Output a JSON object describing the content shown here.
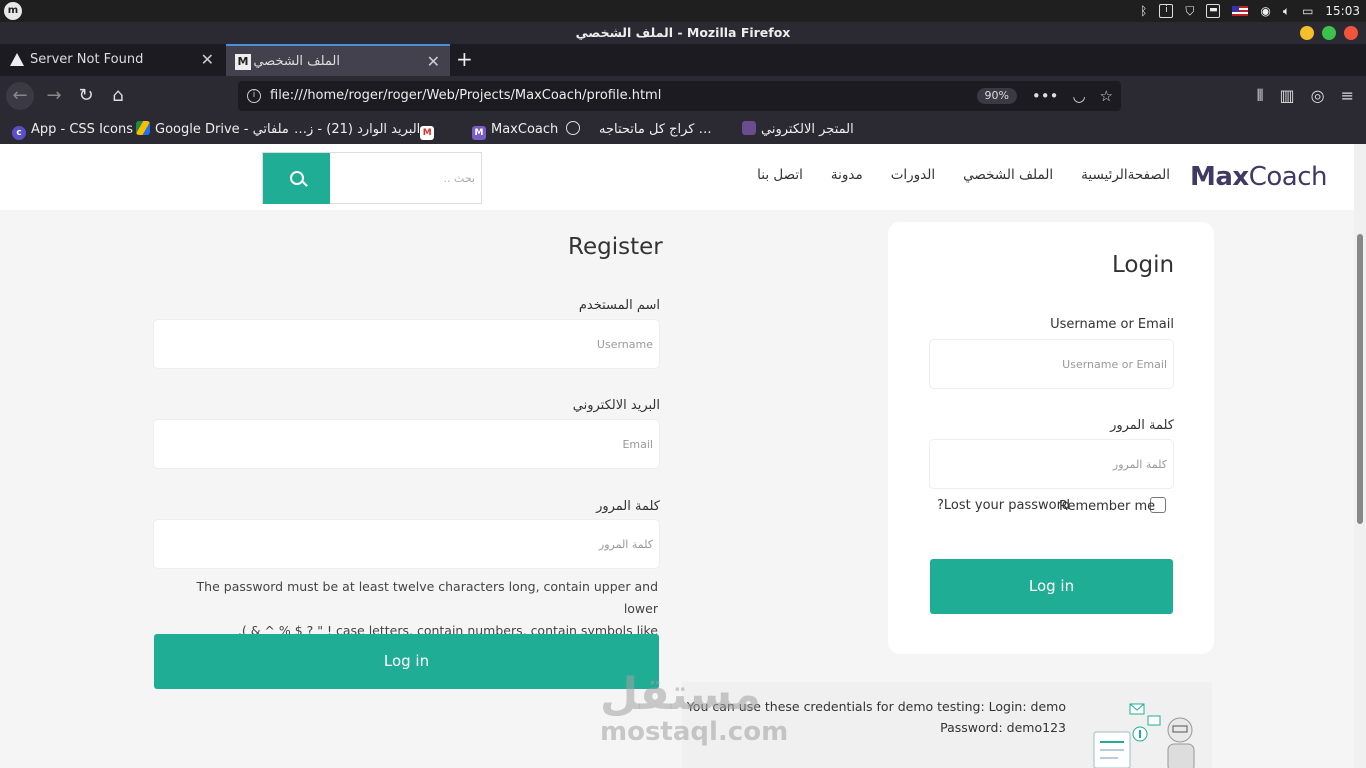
{
  "system": {
    "time": "15:03"
  },
  "window": {
    "title": "الملف الشخصي - Mozilla Firefox"
  },
  "tabs": [
    {
      "label": "Server Not Found"
    },
    {
      "label": "الملف الشخصي"
    }
  ],
  "nav": {
    "url": "file:///home/roger/roger/Web/Projects/MaxCoach/profile.html",
    "zoom": "90%"
  },
  "bookmarks": [
    {
      "label": "App - CSS Icons"
    },
    {
      "label": "Google Drive - ملفاتي"
    },
    {
      "label": "البريد الوارد (21) - ز…"
    },
    {
      "label": "MaxCoach"
    },
    {
      "label": "كراج كل ماتحتاجه …"
    },
    {
      "label": "المتجر الالكتروني"
    }
  ],
  "site": {
    "logo_max": "Max",
    "logo_coach": "Coach",
    "menu": [
      "الصفحةالرئيسية",
      "الملف الشخصي",
      "الدورات",
      "مدونة",
      "اتصل بنا"
    ],
    "search_placeholder": "بحث .."
  },
  "register": {
    "title": "Register",
    "username_label": "اسم المستخدم",
    "username_placeholder": "Username",
    "email_label": "البريد الالكتروني",
    "email_placeholder": "Email",
    "password_label": "كلمة المرور",
    "password_placeholder": "كلمة المرور",
    "hint_line1": "The password must be at least twelve characters long, contain upper and lower",
    "hint_line2": "case letters, contain numbers, contain symbols like ! \" ? $ % ^ & ).",
    "button": "Log in"
  },
  "login": {
    "title": "Login",
    "username_label": "Username or Email",
    "username_placeholder": "Username or Email",
    "password_label": "كلمة المرور",
    "password_placeholder": "كلمة المرور",
    "remember": "Remember me",
    "lost": "Lost your password?",
    "button": "Log in"
  },
  "demo": {
    "line1": "You can use these credentials for demo testing: Login: demo",
    "line2": "Password: demo123"
  },
  "watermark": {
    "arabic": "مستقل",
    "latin": "mostaql.com"
  },
  "colors": {
    "accent": "#20ad96",
    "brand": "#3f3a64"
  }
}
